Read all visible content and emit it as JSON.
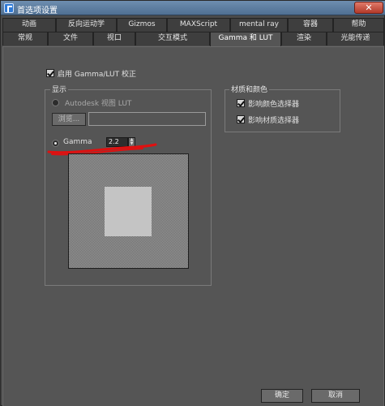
{
  "window": {
    "title": "首选项设置",
    "close_glyph": "✕"
  },
  "tabs_row1": [
    "动画",
    "反向运动学",
    "Gizmos",
    "MAXScript",
    "mental ray",
    "容器",
    "帮助"
  ],
  "tabs_row2": [
    "常规",
    "文件",
    "视口",
    "交互模式",
    "Gamma 和 LUT",
    "渲染",
    "光能传递"
  ],
  "active_tab": "Gamma 和 LUT",
  "enable_gamma": {
    "label": "启用 Gamma/LUT 校正",
    "checked": true
  },
  "display_group": {
    "title": "显示",
    "autodesk_lut": {
      "label": "Autodesk 视图 LUT",
      "selected": false
    },
    "browse_label": "浏览...",
    "path_value": "",
    "gamma": {
      "label": "Gamma",
      "selected": true,
      "value": "2.2"
    }
  },
  "material_group": {
    "title": "材质和颜色",
    "affect_color_selector": {
      "label": "影响颜色选择器",
      "checked": true
    },
    "affect_material_selector": {
      "label": "影响材质选择器",
      "checked": true
    }
  },
  "footer": {
    "ok_label": "确定",
    "cancel_label": "取消"
  },
  "colors": {
    "annotation": "#e01010",
    "panel": "#555555",
    "tab": "#3e3e3e"
  }
}
